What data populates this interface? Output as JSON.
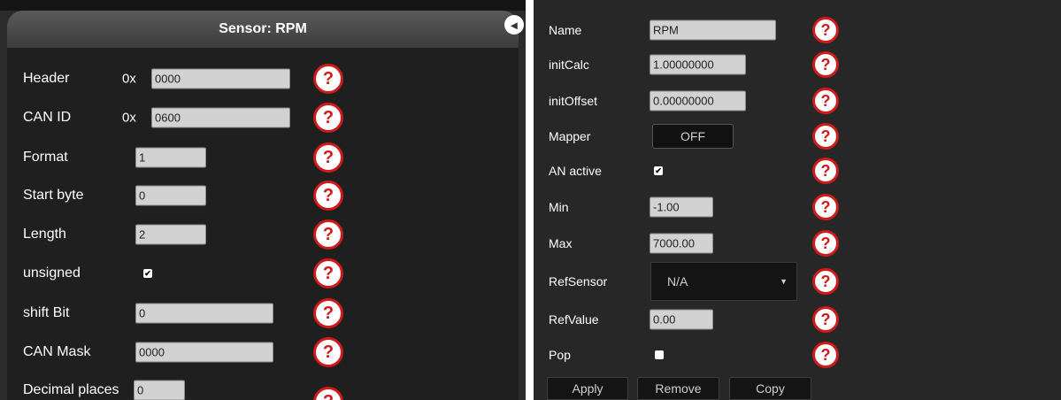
{
  "left": {
    "title": "Sensor: RPM",
    "close_glyph": "◂",
    "help_glyph": "?",
    "check_glyph": "✔",
    "rows": {
      "header": {
        "label": "Header",
        "prefix": "0x",
        "value": "0000"
      },
      "can_id": {
        "label": "CAN ID",
        "prefix": "0x",
        "value": "0600"
      },
      "format": {
        "label": "Format",
        "value": "1"
      },
      "start_byte": {
        "label": "Start byte",
        "value": "0"
      },
      "length": {
        "label": "Length",
        "value": "2"
      },
      "unsigned": {
        "label": "unsigned",
        "checked": true
      },
      "shift_bit": {
        "label": "shift Bit",
        "value": "0"
      },
      "can_mask": {
        "label": "CAN Mask",
        "value": "0000"
      },
      "decimal_places": {
        "label": "Decimal places",
        "value": "0"
      }
    }
  },
  "right": {
    "help_glyph": "?",
    "check_glyph": "✔",
    "rows": {
      "name": {
        "label": "Name",
        "value": "RPM"
      },
      "init_calc": {
        "label": "initCalc",
        "value": "1.00000000"
      },
      "init_offset": {
        "label": "initOffset",
        "value": "0.00000000"
      },
      "mapper": {
        "label": "Mapper",
        "value": "OFF"
      },
      "an_active": {
        "label": "AN active",
        "checked": true
      },
      "min": {
        "label": "Min",
        "value": "-1.00"
      },
      "max": {
        "label": "Max",
        "value": "7000.00"
      },
      "ref_sensor": {
        "label": "RefSensor",
        "value": "N/A",
        "arrow": "▼"
      },
      "ref_value": {
        "label": "RefValue",
        "value": "0.00"
      },
      "pop": {
        "label": "Pop",
        "checked": false
      }
    },
    "buttons": {
      "apply": "Apply",
      "remove": "Remove",
      "copy": "Copy"
    }
  },
  "colors": {
    "help_red": "#d11a1a",
    "panel_bg": "#1f1f1f",
    "field_bg": "#d2d2d2"
  }
}
